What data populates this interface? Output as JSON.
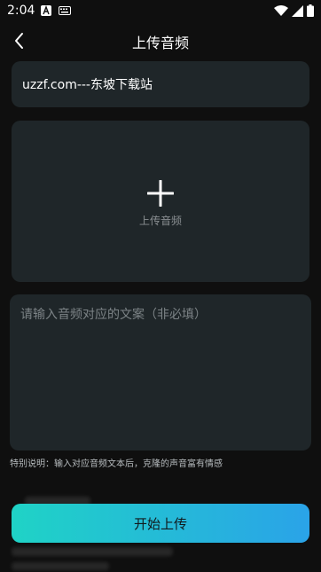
{
  "status_bar": {
    "time": "2:04",
    "icons": [
      "a-icon",
      "keyboard-icon",
      "wifi-icon",
      "signal-icon",
      "battery-icon"
    ]
  },
  "nav": {
    "title": "上传音频"
  },
  "form": {
    "title_value": "uzzf.com---东坡下载站",
    "upload_label": "上传音频",
    "text_placeholder": "请输入音频对应的文案（非必填）",
    "note": "特别说明：输入对应音频文本后，克隆的声音富有情感"
  },
  "actions": {
    "start_label": "开始上传"
  },
  "colors": {
    "background": "#0f0f0f",
    "card": "#1f2629",
    "button_gradient_start": "#1fd3c6",
    "button_gradient_end": "#2aa3e8"
  }
}
